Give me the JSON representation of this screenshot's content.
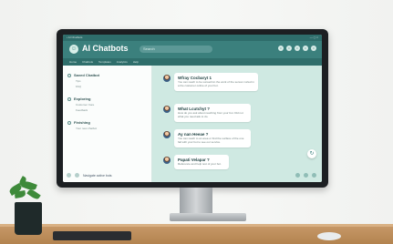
{
  "titlebar": {
    "left": "• AI Chatbots",
    "right": "— ▢ ×"
  },
  "header": {
    "logo_glyph": "☺",
    "title": "AI Chatbots",
    "search_placeholder": "Search",
    "icons": [
      "bell-icon",
      "chat-icon",
      "settings-icon",
      "user-icon",
      "menu-icon"
    ]
  },
  "nav": {
    "items": [
      "Home",
      "Chatbots",
      "Templates",
      "Analytics",
      "Help"
    ]
  },
  "sidebar": {
    "groups": [
      {
        "title": "Saved Chatbot",
        "subs": [
          "Tips",
          "FAQ"
        ]
      },
      {
        "title": "Exploring",
        "subs": [
          "Customer Care",
          "Feedback"
        ]
      },
      {
        "title": "Finishing",
        "subs": [
          "Your new chatbot"
        ]
      }
    ],
    "footer_user": "Navigate active bots"
  },
  "chat": {
    "messages": [
      {
        "title": "Wfray Cocbaryt 1",
        "text": "You can reach to be sunsertinn the work of the sensor curled in a the customer online of your bot."
      },
      {
        "title": "What Lcutchyt ?",
        "text": "How do you ask about reaching from your bot. Did not what you need ask to do."
      },
      {
        "title": "Ay nan Heeae ?",
        "text": "You can reach to an area or find the surface of the one fail with your bot to see our service."
      },
      {
        "title": "Papati Velapar ?",
        "text": "Reference and help text of your bot."
      }
    ],
    "fab_glyph": "↻"
  }
}
